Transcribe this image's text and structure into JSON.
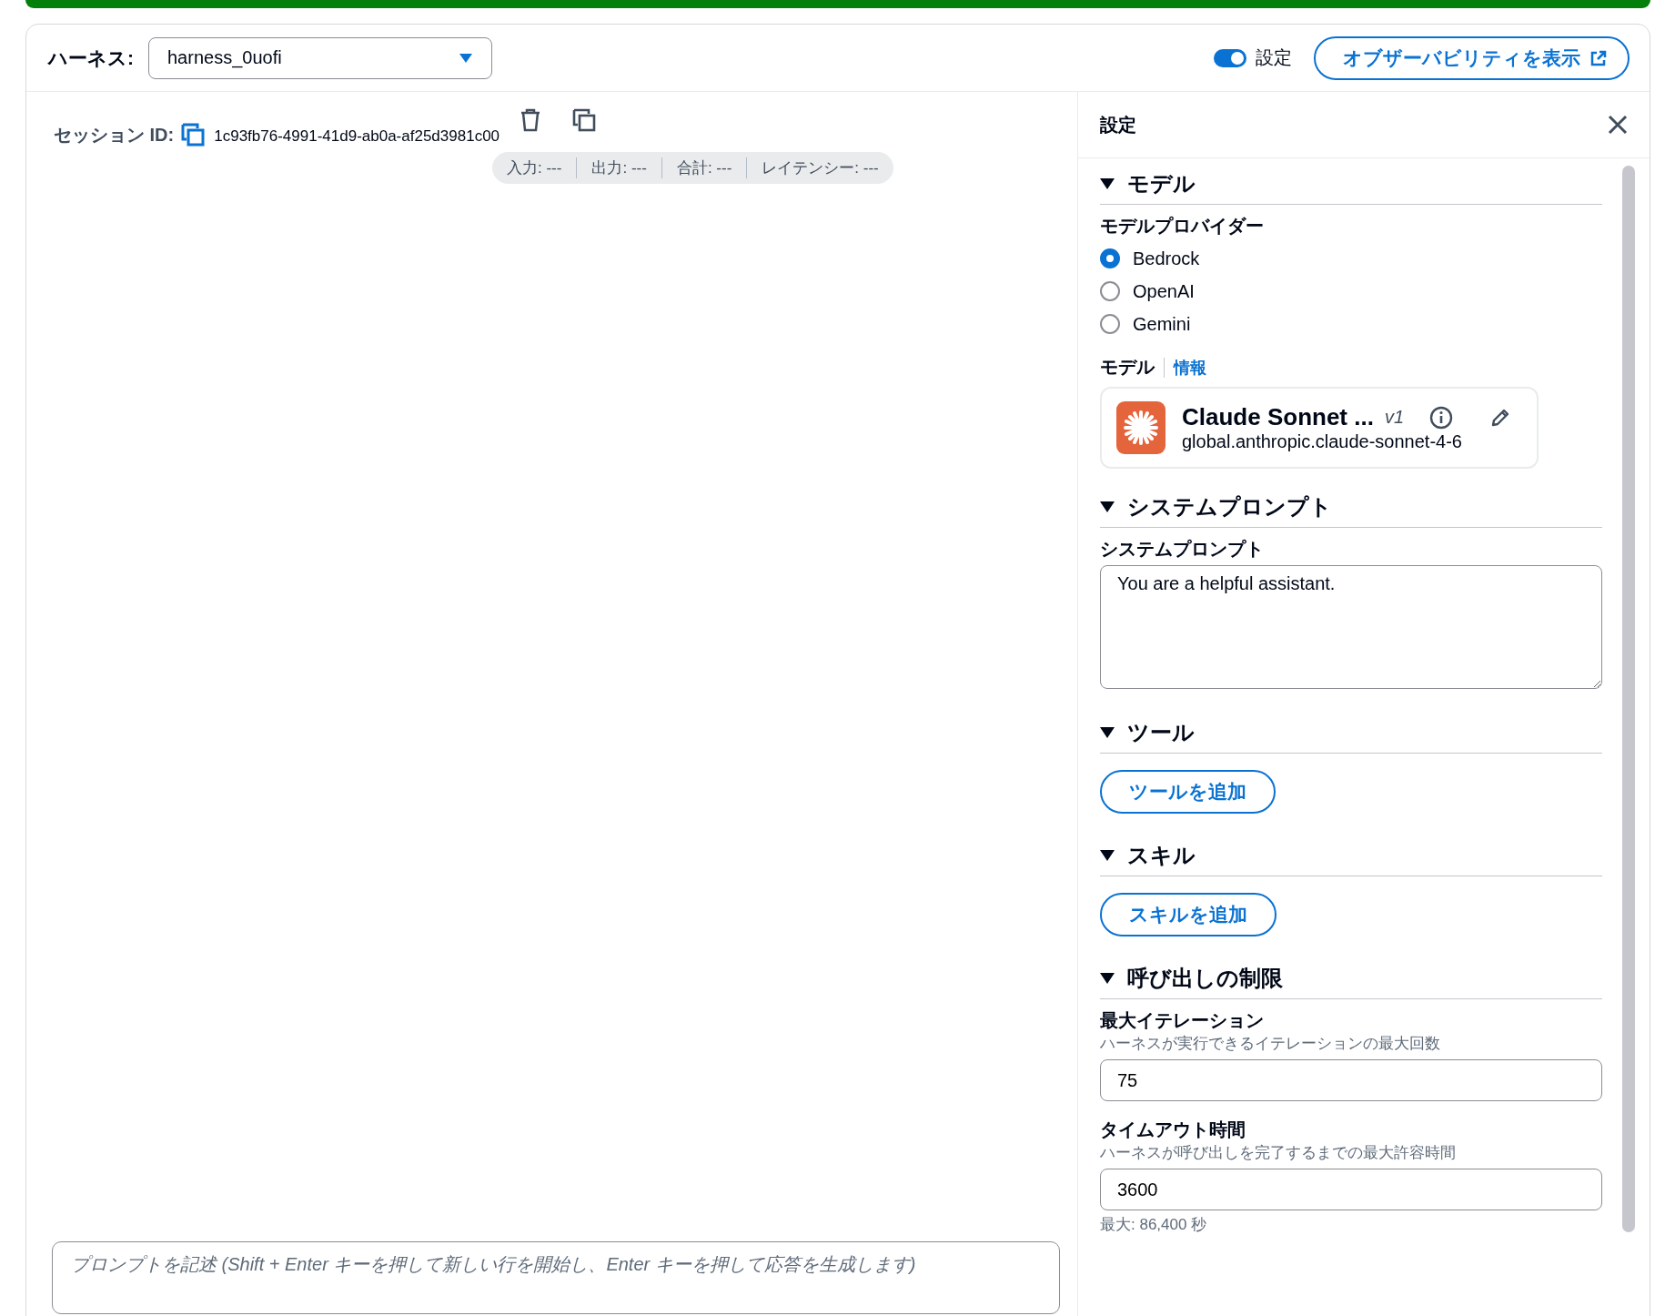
{
  "header": {
    "harness_label": "ハーネス:",
    "harness_select": {
      "value": "harness_0uofi"
    },
    "settings_toggle": {
      "label": "設定",
      "on": true
    },
    "observability_button": "オブザーバビリティを表示"
  },
  "session": {
    "label": "セッション ID:",
    "id": "1c93fb76-4991-41d9-ab0a-af25d3981c00"
  },
  "metrics": [
    "入力: ---",
    "出力: ---",
    "合計: ---",
    "レイテンシー: ---"
  ],
  "prompt": {
    "placeholder": "プロンプトを記述 (Shift + Enter キーを押して新しい行を開始し、Enter キーを押して応答を生成します)"
  },
  "settings": {
    "title": "設定",
    "sections": [
      {
        "kind": "model",
        "title": "モデル",
        "expanded": true,
        "provider_label": "モデルプロバイダー",
        "providers": [
          {
            "label": "Bedrock",
            "selected": true
          },
          {
            "label": "OpenAI",
            "selected": false
          },
          {
            "label": "Gemini",
            "selected": false
          }
        ],
        "model_label": "モデル",
        "info_link": "情報",
        "model": {
          "name": "Claude Sonnet ...",
          "version": "v1",
          "id": "global.anthropic.claude-sonnet-4-6"
        }
      },
      {
        "kind": "prompt",
        "title": "システムプロンプト",
        "expanded": true,
        "label": "システムプロンプト",
        "value": "You are a helpful assistant."
      },
      {
        "kind": "add",
        "title": "ツール",
        "expanded": true,
        "button": "ツールを追加"
      },
      {
        "kind": "add",
        "title": "スキル",
        "expanded": true,
        "button": "スキルを追加"
      },
      {
        "kind": "limits",
        "title": "呼び出しの制限",
        "expanded": true,
        "fields": [
          {
            "label": "最大イテレーション",
            "description": "ハーネスが実行できるイテレーションの最大回数",
            "value": "75"
          },
          {
            "label": "タイムアウト時間",
            "description": "ハーネスが呼び出しを完了するまでの最大許容時間",
            "value": "3600",
            "hint": "最大: 86,400 秒"
          }
        ]
      }
    ]
  }
}
